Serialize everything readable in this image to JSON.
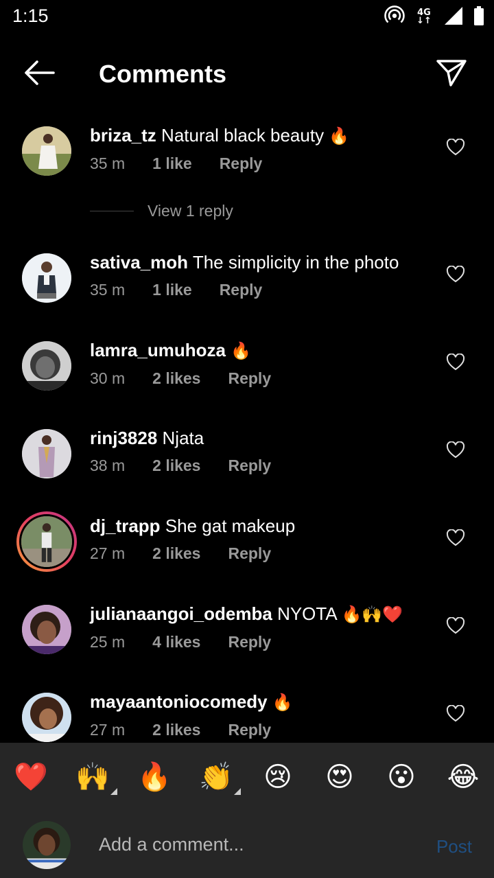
{
  "status_bar": {
    "time": "1:15",
    "network_top": "4G",
    "network_bottom": "↓↑",
    "icons": [
      "hotspot-icon",
      "signal-icon",
      "battery-icon"
    ]
  },
  "header": {
    "title": "Comments",
    "back_icon": "arrow-left-icon",
    "share_icon": "paper-plane-icon"
  },
  "comments": [
    {
      "username": "briza_tz",
      "text": "Natural black beauty",
      "emoji": "🔥",
      "time": "35 m",
      "likes": "1 like",
      "reply": "Reply",
      "avatar_colors": [
        "#cdbf95",
        "#6a7f3c",
        "#f3f1ec"
      ]
    },
    {
      "username": "sativa_moh",
      "text": "The simplicity in the photo",
      "emoji": "",
      "time": "35 m",
      "likes": "1 like",
      "reply": "Reply",
      "avatar_colors": [
        "#e9eef4",
        "#2b3340",
        "#7a5a44"
      ]
    },
    {
      "username": "lamra_umuhoza",
      "text": "",
      "emoji": "🔥",
      "time": "30 m",
      "likes": "2 likes",
      "reply": "Reply",
      "avatar_colors": [
        "#d8d8d8",
        "#3a3a3a",
        "#6d6d6d"
      ]
    },
    {
      "username": "rinj3828",
      "text": "Njata",
      "emoji": "",
      "time": "38 m",
      "likes": "2 likes",
      "reply": "Reply",
      "avatar_colors": [
        "#d9d7dc",
        "#b39bb4",
        "#caa45a"
      ]
    },
    {
      "username": "dj_trapp",
      "text": "She gat makeup",
      "emoji": "",
      "time": "27 m",
      "likes": "2 likes",
      "reply": "Reply",
      "avatar_colors": [
        "#7c8f6a",
        "#2e3b22",
        "#e8e8e8"
      ]
    },
    {
      "username": "julianaangoi_odemba",
      "text": "NYOTA",
      "emoji": "🔥🙌❤️",
      "time": "25 m",
      "likes": "4 likes",
      "reply": "Reply",
      "avatar_colors": [
        "#c9a2cc",
        "#3e2a20",
        "#8a5a44"
      ]
    },
    {
      "username": "mayaantoniocomedy",
      "text": "",
      "emoji": "🔥",
      "time": "27 m",
      "likes": "2 likes",
      "reply": "Reply",
      "avatar_colors": [
        "#cfe0f0",
        "#4a2e22",
        "#a5714f"
      ]
    }
  ],
  "view_replies": "View 1 reply",
  "quick_emojis": [
    {
      "name": "red-heart-emoji",
      "char": "❤️",
      "has_variants": false
    },
    {
      "name": "raising-hands-emoji",
      "char": "🙌",
      "has_variants": true
    },
    {
      "name": "fire-emoji",
      "char": "🔥",
      "has_variants": false
    },
    {
      "name": "clapping-hands-emoji",
      "char": "👏",
      "has_variants": true
    },
    {
      "name": "crying-face-emoji",
      "char": "😢",
      "has_variants": false
    },
    {
      "name": "heart-eyes-emoji",
      "char": "😍",
      "has_variants": false
    },
    {
      "name": "surprised-face-emoji",
      "char": "😮",
      "has_variants": false
    },
    {
      "name": "tears-of-joy-emoji",
      "char": "😂",
      "has_variants": false
    }
  ],
  "composer": {
    "placeholder": "Add a comment...",
    "post_label": "Post",
    "post_color": "#1f4f82"
  },
  "colors": {
    "background": "#000000",
    "bar_background": "#262626",
    "muted_text": "#9a9a9a",
    "story_ring": [
      "#f9a13a",
      "#e4405f",
      "#c13584"
    ]
  }
}
